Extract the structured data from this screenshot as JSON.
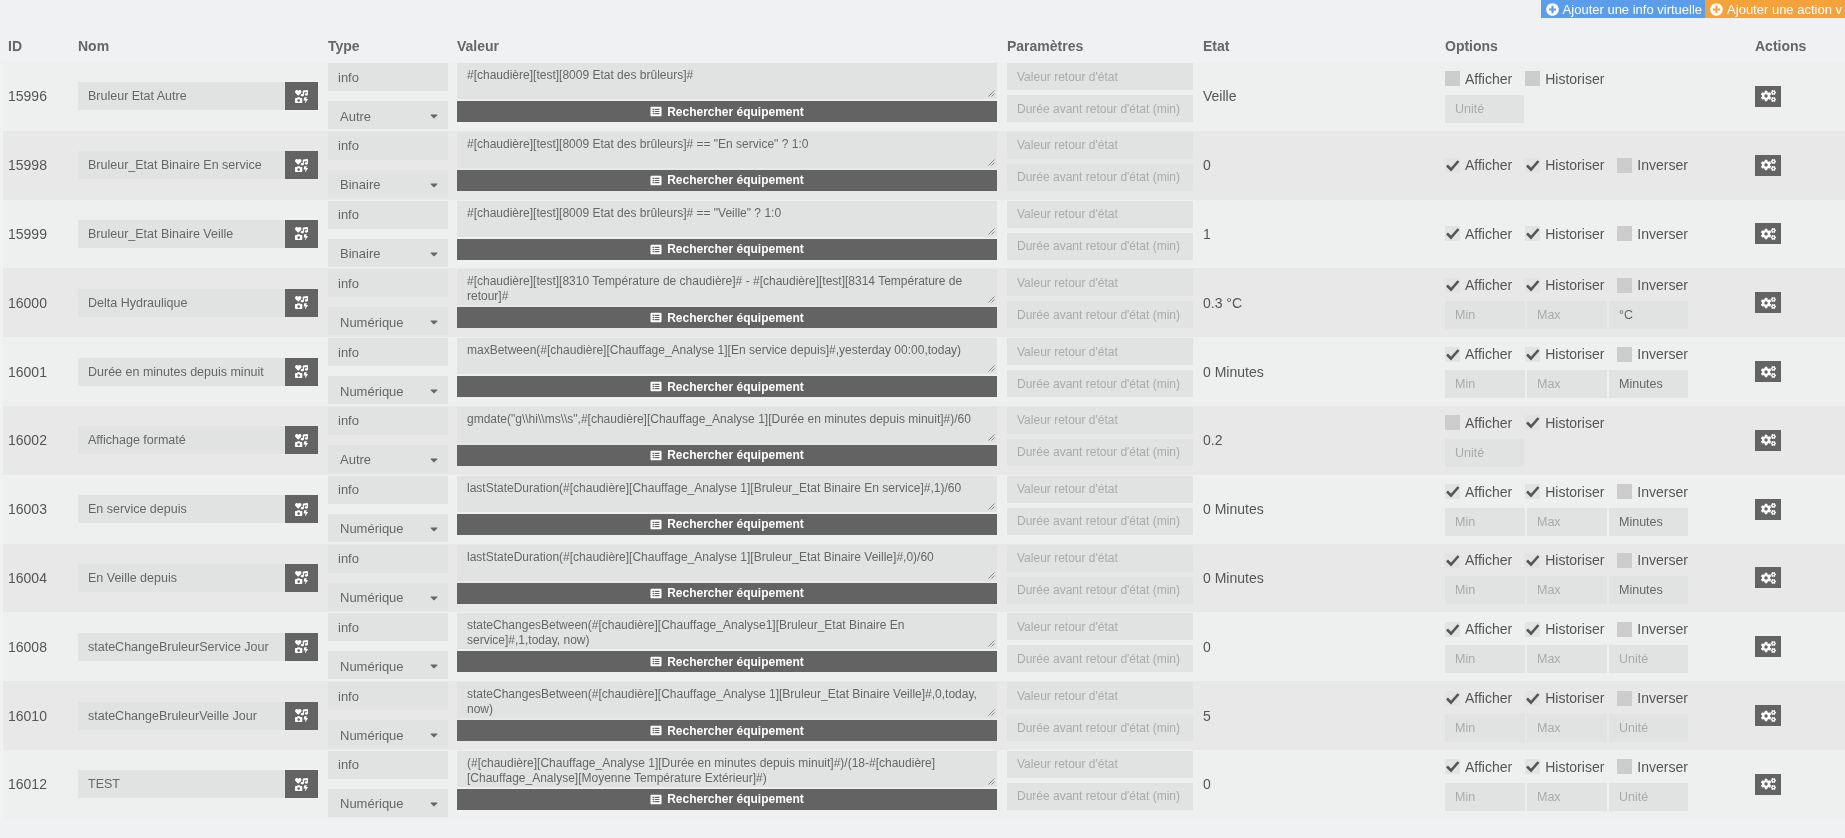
{
  "toolbar": {
    "buttons": [
      {
        "kind": "info",
        "label": "Ajouter une info virtuelle"
      },
      {
        "kind": "action",
        "label": "Ajouter une action v"
      }
    ]
  },
  "table": {
    "columns": [
      "ID",
      "Nom",
      "Type",
      "Valeur",
      "Paramètres",
      "Etat",
      "Options",
      "Actions"
    ],
    "rows": [
      {
        "id": "15996",
        "name": "Bruleur Etat Autre",
        "type": "info",
        "subtype": "Autre",
        "value": "#[chaudière][test][8009 Etat des brûleurs]#",
        "search_button": "Rechercher équipement",
        "params": [
          {
            "placeholder": "Valeur retour d'état"
          },
          {
            "placeholder": "Durée avant retour d'état (min)"
          }
        ],
        "state": "Veille",
        "options": [
          {
            "label": "Afficher",
            "checked": false
          },
          {
            "label": "Historiser",
            "checked": false
          }
        ],
        "fields": [
          {
            "kind": "unit",
            "placeholder": "Unité"
          }
        ]
      },
      {
        "id": "15998",
        "name": "Bruleur_Etat Binaire En service",
        "type": "info",
        "subtype": "Binaire",
        "value": "#[chaudière][test][8009 Etat des brûleurs]# == \"En service\" ? 1:0",
        "search_button": "Rechercher équipement",
        "params": [
          {
            "placeholder": "Valeur retour d'état"
          },
          {
            "placeholder": "Durée avant retour d'état (min)"
          }
        ],
        "state": "0",
        "options": [
          {
            "label": "Afficher",
            "checked": true
          },
          {
            "label": "Historiser",
            "checked": true
          },
          {
            "label": "Inverser",
            "checked": false
          }
        ]
      },
      {
        "id": "15999",
        "name": "Bruleur_Etat Binaire Veille",
        "type": "info",
        "subtype": "Binaire",
        "value": "#[chaudière][test][8009 Etat des brûleurs]# == \"Veille\" ? 1:0",
        "search_button": "Rechercher équipement",
        "params": [
          {
            "placeholder": "Valeur retour d'état"
          },
          {
            "placeholder": "Durée avant retour d'état (min)"
          }
        ],
        "state": "1",
        "options": [
          {
            "label": "Afficher",
            "checked": true
          },
          {
            "label": "Historiser",
            "checked": true
          },
          {
            "label": "Inverser",
            "checked": false
          }
        ]
      },
      {
        "id": "16000",
        "name": "Delta Hydraulique",
        "type": "info",
        "subtype": "Numérique",
        "value": "#[chaudière][test][8310 Température de chaudière]# - #[chaudière][test][8314 Température de retour]#",
        "search_button": "Rechercher équipement",
        "params": [
          {
            "placeholder": "Valeur retour d'état"
          },
          {
            "placeholder": "Durée avant retour d'état (min)"
          }
        ],
        "state": "0.3 °C",
        "options": [
          {
            "label": "Afficher",
            "checked": true
          },
          {
            "label": "Historiser",
            "checked": true
          },
          {
            "label": "Inverser",
            "checked": false
          }
        ],
        "fields": [
          {
            "kind": "min",
            "placeholder": "Min"
          },
          {
            "kind": "max",
            "placeholder": "Max"
          },
          {
            "kind": "unit",
            "value": "°C"
          }
        ]
      },
      {
        "id": "16001",
        "name": "Durée en minutes depuis minuit",
        "type": "info",
        "subtype": "Numérique",
        "value": "maxBetween(#[chaudière][Chauffage_Analyse 1][En service depuis]#,yesterday 00:00,today)",
        "search_button": "Rechercher équipement",
        "params": [
          {
            "placeholder": "Valeur retour d'état"
          },
          {
            "placeholder": "Durée avant retour d'état (min)"
          }
        ],
        "state": "0 Minutes",
        "options": [
          {
            "label": "Afficher",
            "checked": true
          },
          {
            "label": "Historiser",
            "checked": true
          },
          {
            "label": "Inverser",
            "checked": false
          }
        ],
        "fields": [
          {
            "kind": "min",
            "placeholder": "Min"
          },
          {
            "kind": "max",
            "placeholder": "Max"
          },
          {
            "kind": "unit",
            "value": "Minutes"
          }
        ]
      },
      {
        "id": "16002",
        "name": "Affichage formaté",
        "type": "info",
        "subtype": "Autre",
        "value": "gmdate(\"g\\\\hi\\\\ms\\\\s\",#[chaudière][Chauffage_Analyse 1][Durée en minutes depuis minuit]#)/60",
        "search_button": "Rechercher équipement",
        "params": [
          {
            "placeholder": "Valeur retour d'état"
          },
          {
            "placeholder": "Durée avant retour d'état (min)"
          }
        ],
        "state": "0.2",
        "options": [
          {
            "label": "Afficher",
            "checked": false
          },
          {
            "label": "Historiser",
            "checked": true
          }
        ],
        "fields": [
          {
            "kind": "unit",
            "placeholder": "Unité"
          }
        ]
      },
      {
        "id": "16003",
        "name": "En service depuis",
        "type": "info",
        "subtype": "Numérique",
        "value": "lastStateDuration(#[chaudière][Chauffage_Analyse 1][Bruleur_Etat Binaire En service]#,1)/60",
        "search_button": "Rechercher équipement",
        "params": [
          {
            "placeholder": "Valeur retour d'état"
          },
          {
            "placeholder": "Durée avant retour d'état (min)"
          }
        ],
        "state": "0 Minutes",
        "options": [
          {
            "label": "Afficher",
            "checked": true
          },
          {
            "label": "Historiser",
            "checked": true
          },
          {
            "label": "Inverser",
            "checked": false
          }
        ],
        "fields": [
          {
            "kind": "min",
            "placeholder": "Min"
          },
          {
            "kind": "max",
            "placeholder": "Max"
          },
          {
            "kind": "unit",
            "value": "Minutes"
          }
        ]
      },
      {
        "id": "16004",
        "name": "En Veille depuis",
        "type": "info",
        "subtype": "Numérique",
        "value": "lastStateDuration(#[chaudière][Chauffage_Analyse 1][Bruleur_Etat Binaire Veille]#,0)/60",
        "search_button": "Rechercher équipement",
        "params": [
          {
            "placeholder": "Valeur retour d'état"
          },
          {
            "placeholder": "Durée avant retour d'état (min)"
          }
        ],
        "state": "0 Minutes",
        "options": [
          {
            "label": "Afficher",
            "checked": true
          },
          {
            "label": "Historiser",
            "checked": true
          },
          {
            "label": "Inverser",
            "checked": false
          }
        ],
        "fields": [
          {
            "kind": "min",
            "placeholder": "Min"
          },
          {
            "kind": "max",
            "placeholder": "Max"
          },
          {
            "kind": "unit",
            "value": "Minutes"
          }
        ]
      },
      {
        "id": "16008",
        "name": "stateChangeBruleurService Jour",
        "type": "info",
        "subtype": "Numérique",
        "value": "stateChangesBetween(#[chaudière][Chauffage_Analyse1][Bruleur_Etat Binaire En service]#,1,today, now)",
        "search_button": "Rechercher équipement",
        "params": [
          {
            "placeholder": "Valeur retour d'état"
          },
          {
            "placeholder": "Durée avant retour d'état (min)"
          }
        ],
        "state": "0",
        "options": [
          {
            "label": "Afficher",
            "checked": true
          },
          {
            "label": "Historiser",
            "checked": true
          },
          {
            "label": "Inverser",
            "checked": false
          }
        ],
        "fields": [
          {
            "kind": "min",
            "placeholder": "Min"
          },
          {
            "kind": "max",
            "placeholder": "Max"
          },
          {
            "kind": "unit",
            "placeholder": "Unité"
          }
        ]
      },
      {
        "id": "16010",
        "name": "stateChangeBruleurVeille Jour",
        "type": "info",
        "subtype": "Numérique",
        "value": "stateChangesBetween(#[chaudière][Chauffage_Analyse 1][Bruleur_Etat Binaire Veille]#,0,today, now)",
        "search_button": "Rechercher équipement",
        "params": [
          {
            "placeholder": "Valeur retour d'état"
          },
          {
            "placeholder": "Durée avant retour d'état (min)"
          }
        ],
        "state": "5",
        "options": [
          {
            "label": "Afficher",
            "checked": true
          },
          {
            "label": "Historiser",
            "checked": true
          },
          {
            "label": "Inverser",
            "checked": false
          }
        ],
        "fields": [
          {
            "kind": "min",
            "placeholder": "Min"
          },
          {
            "kind": "max",
            "placeholder": "Max"
          },
          {
            "kind": "unit",
            "placeholder": "Unité"
          }
        ]
      },
      {
        "id": "16012",
        "name": "TEST",
        "type": "info",
        "subtype": "Numérique",
        "value": "(#[chaudière][Chauffage_Analyse 1][Durée en minutes depuis minuit]#)/(18-#[chaudière][Chauffage_Analyse][Moyenne Température Extérieur]#)",
        "search_button": "Rechercher équipement",
        "params": [
          {
            "placeholder": "Valeur retour d'état"
          },
          {
            "placeholder": "Durée avant retour d'état (min)"
          }
        ],
        "state": "0",
        "options": [
          {
            "label": "Afficher",
            "checked": true
          },
          {
            "label": "Historiser",
            "checked": true
          },
          {
            "label": "Inverser",
            "checked": false
          }
        ],
        "fields": [
          {
            "kind": "min",
            "placeholder": "Min"
          },
          {
            "kind": "max",
            "placeholder": "Max"
          },
          {
            "kind": "unit",
            "placeholder": "Unité"
          }
        ]
      }
    ]
  }
}
